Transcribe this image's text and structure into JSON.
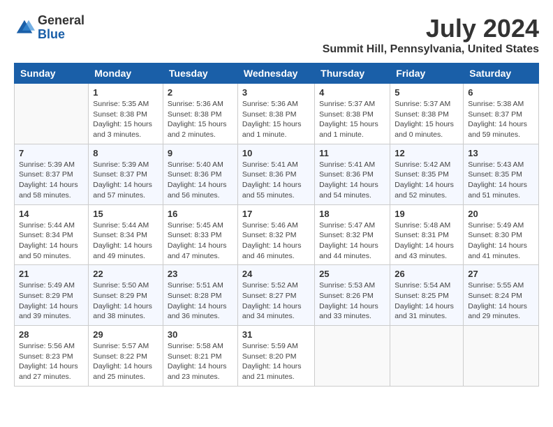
{
  "header": {
    "logo": {
      "general": "General",
      "blue": "Blue"
    },
    "title": "July 2024",
    "location": "Summit Hill, Pennsylvania, United States"
  },
  "weekdays": [
    "Sunday",
    "Monday",
    "Tuesday",
    "Wednesday",
    "Thursday",
    "Friday",
    "Saturday"
  ],
  "weeks": [
    [
      {
        "day": "",
        "info": ""
      },
      {
        "day": "1",
        "info": "Sunrise: 5:35 AM\nSunset: 8:38 PM\nDaylight: 15 hours\nand 3 minutes."
      },
      {
        "day": "2",
        "info": "Sunrise: 5:36 AM\nSunset: 8:38 PM\nDaylight: 15 hours\nand 2 minutes."
      },
      {
        "day": "3",
        "info": "Sunrise: 5:36 AM\nSunset: 8:38 PM\nDaylight: 15 hours\nand 1 minute."
      },
      {
        "day": "4",
        "info": "Sunrise: 5:37 AM\nSunset: 8:38 PM\nDaylight: 15 hours\nand 1 minute."
      },
      {
        "day": "5",
        "info": "Sunrise: 5:37 AM\nSunset: 8:38 PM\nDaylight: 15 hours\nand 0 minutes."
      },
      {
        "day": "6",
        "info": "Sunrise: 5:38 AM\nSunset: 8:37 PM\nDaylight: 14 hours\nand 59 minutes."
      }
    ],
    [
      {
        "day": "7",
        "info": "Sunrise: 5:39 AM\nSunset: 8:37 PM\nDaylight: 14 hours\nand 58 minutes."
      },
      {
        "day": "8",
        "info": "Sunrise: 5:39 AM\nSunset: 8:37 PM\nDaylight: 14 hours\nand 57 minutes."
      },
      {
        "day": "9",
        "info": "Sunrise: 5:40 AM\nSunset: 8:36 PM\nDaylight: 14 hours\nand 56 minutes."
      },
      {
        "day": "10",
        "info": "Sunrise: 5:41 AM\nSunset: 8:36 PM\nDaylight: 14 hours\nand 55 minutes."
      },
      {
        "day": "11",
        "info": "Sunrise: 5:41 AM\nSunset: 8:36 PM\nDaylight: 14 hours\nand 54 minutes."
      },
      {
        "day": "12",
        "info": "Sunrise: 5:42 AM\nSunset: 8:35 PM\nDaylight: 14 hours\nand 52 minutes."
      },
      {
        "day": "13",
        "info": "Sunrise: 5:43 AM\nSunset: 8:35 PM\nDaylight: 14 hours\nand 51 minutes."
      }
    ],
    [
      {
        "day": "14",
        "info": "Sunrise: 5:44 AM\nSunset: 8:34 PM\nDaylight: 14 hours\nand 50 minutes."
      },
      {
        "day": "15",
        "info": "Sunrise: 5:44 AM\nSunset: 8:34 PM\nDaylight: 14 hours\nand 49 minutes."
      },
      {
        "day": "16",
        "info": "Sunrise: 5:45 AM\nSunset: 8:33 PM\nDaylight: 14 hours\nand 47 minutes."
      },
      {
        "day": "17",
        "info": "Sunrise: 5:46 AM\nSunset: 8:32 PM\nDaylight: 14 hours\nand 46 minutes."
      },
      {
        "day": "18",
        "info": "Sunrise: 5:47 AM\nSunset: 8:32 PM\nDaylight: 14 hours\nand 44 minutes."
      },
      {
        "day": "19",
        "info": "Sunrise: 5:48 AM\nSunset: 8:31 PM\nDaylight: 14 hours\nand 43 minutes."
      },
      {
        "day": "20",
        "info": "Sunrise: 5:49 AM\nSunset: 8:30 PM\nDaylight: 14 hours\nand 41 minutes."
      }
    ],
    [
      {
        "day": "21",
        "info": "Sunrise: 5:49 AM\nSunset: 8:29 PM\nDaylight: 14 hours\nand 39 minutes."
      },
      {
        "day": "22",
        "info": "Sunrise: 5:50 AM\nSunset: 8:29 PM\nDaylight: 14 hours\nand 38 minutes."
      },
      {
        "day": "23",
        "info": "Sunrise: 5:51 AM\nSunset: 8:28 PM\nDaylight: 14 hours\nand 36 minutes."
      },
      {
        "day": "24",
        "info": "Sunrise: 5:52 AM\nSunset: 8:27 PM\nDaylight: 14 hours\nand 34 minutes."
      },
      {
        "day": "25",
        "info": "Sunrise: 5:53 AM\nSunset: 8:26 PM\nDaylight: 14 hours\nand 33 minutes."
      },
      {
        "day": "26",
        "info": "Sunrise: 5:54 AM\nSunset: 8:25 PM\nDaylight: 14 hours\nand 31 minutes."
      },
      {
        "day": "27",
        "info": "Sunrise: 5:55 AM\nSunset: 8:24 PM\nDaylight: 14 hours\nand 29 minutes."
      }
    ],
    [
      {
        "day": "28",
        "info": "Sunrise: 5:56 AM\nSunset: 8:23 PM\nDaylight: 14 hours\nand 27 minutes."
      },
      {
        "day": "29",
        "info": "Sunrise: 5:57 AM\nSunset: 8:22 PM\nDaylight: 14 hours\nand 25 minutes."
      },
      {
        "day": "30",
        "info": "Sunrise: 5:58 AM\nSunset: 8:21 PM\nDaylight: 14 hours\nand 23 minutes."
      },
      {
        "day": "31",
        "info": "Sunrise: 5:59 AM\nSunset: 8:20 PM\nDaylight: 14 hours\nand 21 minutes."
      },
      {
        "day": "",
        "info": ""
      },
      {
        "day": "",
        "info": ""
      },
      {
        "day": "",
        "info": ""
      }
    ]
  ]
}
